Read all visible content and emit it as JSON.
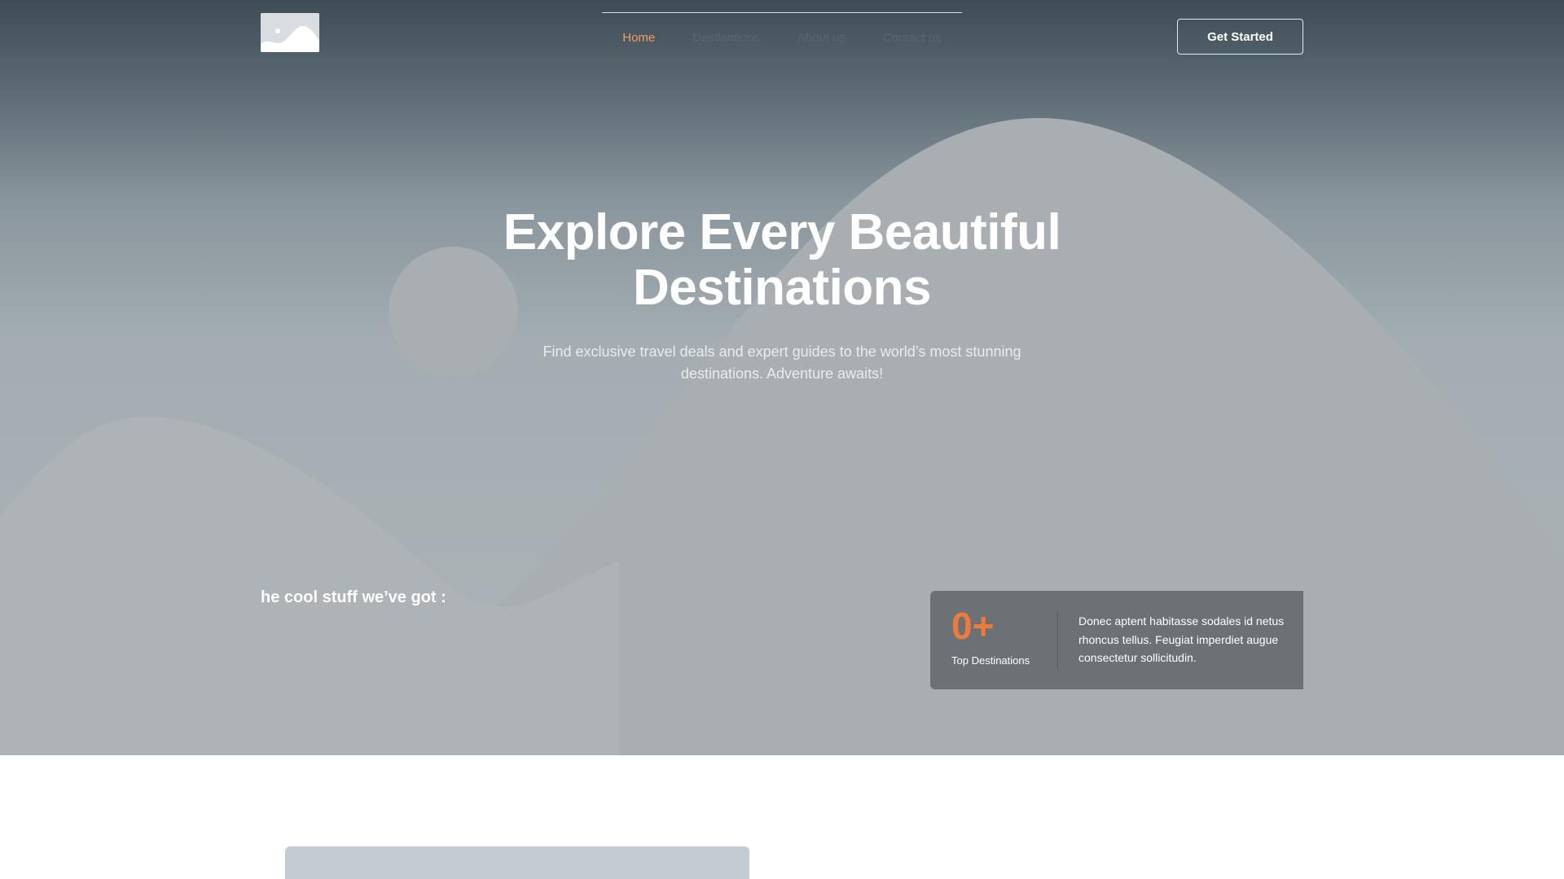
{
  "header": {
    "logo_icon": "image-placeholder-icon",
    "nav": [
      {
        "label": "Home",
        "active": true
      },
      {
        "label": "Destiantions",
        "active": false
      },
      {
        "label": "About us",
        "active": false
      },
      {
        "label": "Contact us",
        "active": false
      }
    ],
    "cta_label": "Get Started"
  },
  "hero": {
    "title_line1": "Explore Every Beautiful",
    "title_line2": "Destinations",
    "subtitle": "Find exclusive travel deals and expert guides to the world’s most stunning destinations. Adventure awaits!"
  },
  "features": {
    "heading": "he cool stuff we’ve got :"
  },
  "stats": {
    "number": "0+",
    "label": "Top Destinations",
    "description": "Donec aptent habitasse sodales id netus rhoncus tellus. Feugiat imperdiet augue consectetur sollicitudin."
  },
  "colors": {
    "accent": "#f07a3a",
    "nav_active": "#f39b62",
    "stat_card_bg": "#6b7175"
  }
}
